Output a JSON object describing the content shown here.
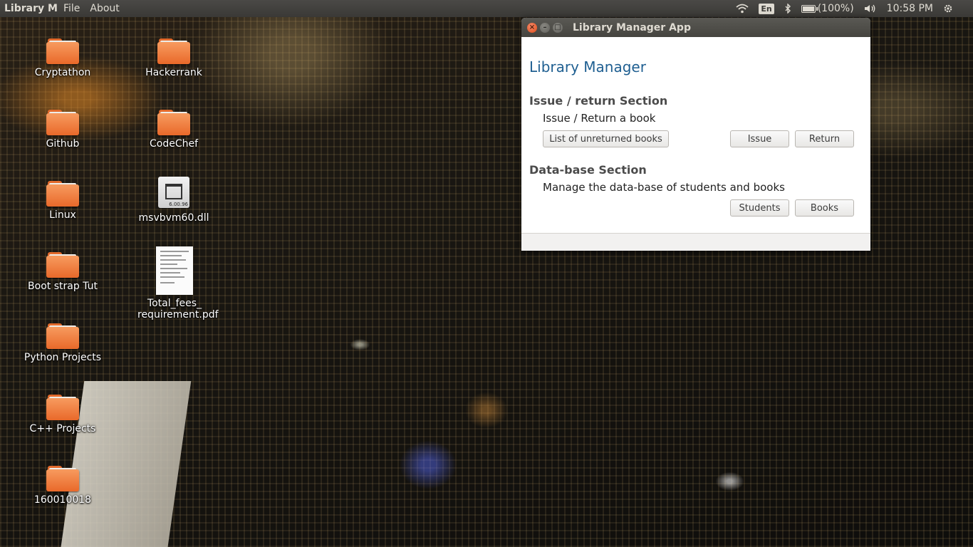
{
  "top_panel": {
    "app_title": "Library M",
    "menu": [
      "File",
      "About"
    ],
    "lang": "En",
    "battery": "(100%)",
    "clock": "10:58 PM"
  },
  "desktop_icons": [
    {
      "label": "Cryptathon",
      "type": "folder"
    },
    {
      "label": "Hackerrank",
      "type": "folder"
    },
    {
      "label": "Github",
      "type": "folder"
    },
    {
      "label": "CodeChef",
      "type": "folder"
    },
    {
      "label": "Linux",
      "type": "folder"
    },
    {
      "label": "msvbvm60.dll",
      "type": "dll",
      "badge": "6.00.96"
    },
    {
      "label": "Boot strap Tut",
      "type": "folder"
    },
    {
      "label": "Total_fees_ requirement.pdf",
      "type": "pdf"
    },
    {
      "label": "Python Projects",
      "type": "folder"
    },
    {
      "label": "C++ Projects",
      "type": "folder"
    },
    {
      "label": "160010018",
      "type": "folder"
    }
  ],
  "window": {
    "title": "Library Manager App",
    "heading": "Library Manager",
    "issue_section": {
      "heading": "Issue / return Section",
      "description": "Issue / Return a book",
      "list_button": "List of unreturned books",
      "issue_button": "Issue",
      "return_button": "Return"
    },
    "db_section": {
      "heading": "Data-base Section",
      "description": "Manage the data-base of students and books",
      "students_button": "Students",
      "books_button": "Books"
    }
  }
}
